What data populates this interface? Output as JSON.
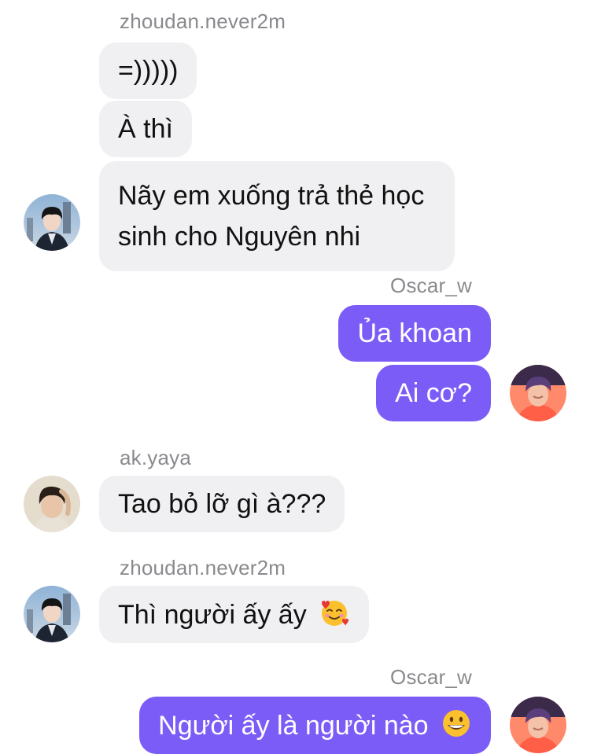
{
  "messages": [
    {
      "sender": "zhoudan.never2m",
      "side": "left",
      "texts": [
        "=)))))",
        "À thì",
        "Nãy em xuống trả thẻ học sinh cho Nguyên nhi"
      ],
      "avatar": "avatar-zhoudan"
    },
    {
      "sender": "Oscar_w",
      "side": "right",
      "texts": [
        "Ủa khoan",
        "Ai cơ?"
      ],
      "avatar": "avatar-oscar"
    },
    {
      "sender": "ak.yaya",
      "side": "left",
      "texts": [
        "Tao bỏ lỡ gì à???"
      ],
      "avatar": "avatar-akyaya"
    },
    {
      "sender": "zhoudan.never2m",
      "side": "left",
      "texts": [
        "Thì người ấy ấy"
      ],
      "emoji": "smiling-face-with-hearts-icon",
      "avatar": "avatar-zhoudan"
    },
    {
      "sender": "Oscar_w",
      "side": "right",
      "texts": [
        "Người ấy là người nào"
      ],
      "emoji": "grinning-face-icon",
      "avatar": "avatar-oscar"
    }
  ],
  "colors": {
    "incoming_bubble": "#f0f0f2",
    "outgoing_bubble": "#7b5cf7",
    "sender_name": "#8a8a8e"
  }
}
